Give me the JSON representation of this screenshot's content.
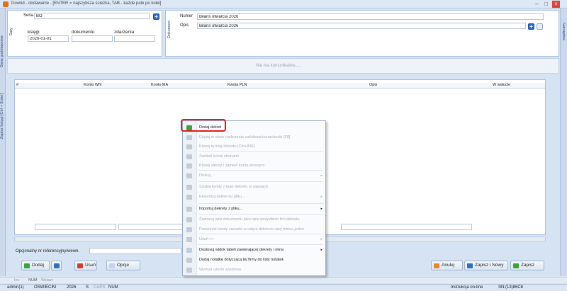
{
  "window": {
    "title": "Dowód - dodawanie - [ENTER = najszybsza ścieżka, TAB - każde pole po kolei]",
    "min": "–",
    "max": "□",
    "close": "×"
  },
  "left_tabs": [
    "Dane podstawowe",
    "Daty",
    "Zapisz księgi [Ctrl + Enter]"
  ],
  "right_tab": "Narzędzia",
  "header": {
    "seria_label": "Seria",
    "seria_value": "BO",
    "daty_label": "Daty",
    "ksiegi_label": "księgi",
    "dokumentu_label": "dokumentu",
    "zdarzenia_label": "zdarzenia",
    "ksiegi_value": "2026-01-01",
    "dokumentu_value": "",
    "zdarzenia_value": "",
    "dokument_tab": "Dokument",
    "numer_label": "Numer",
    "numer_value": "Bilans otwarcia 2026",
    "opis_label": "Opis",
    "opis_value": "Bilans otwarcia 2026"
  },
  "messages": "Nie ma komunikatów.....",
  "grid": {
    "columns": [
      "#",
      "Konto WN",
      "Konto MA",
      "Kwota PLN",
      "Opis",
      "W walucie"
    ]
  },
  "referencyjny_label": "Opcjonalny nr referencyjny/wewn.",
  "buttons": {
    "dodaj": "Dodaj",
    "usun": "Usuń",
    "opcje": "Opcje",
    "anuluj": "Anuluj",
    "zapisz_nowy": "Zapisz i Nowy",
    "zapisz": "Zapisz"
  },
  "context_menu": [
    {
      "label": "Dodaj dekret",
      "disabled": false,
      "icon": "plus-icon",
      "color": "#3aa33a"
    },
    {
      "label": "Edytuj w oknie rozliczenia walutowe/rozrachunki [F8]",
      "disabled": true,
      "icon": "edit-icon"
    },
    {
      "label": "Klonuj tę linię dekretu [Ctrl+INS]",
      "disabled": true,
      "icon": "clone-icon"
    },
    {
      "label": "Zamień konta stronami",
      "disabled": true,
      "icon": "swap-icon"
    },
    {
      "label": "Klonuj wiersz i zamień konta stronami",
      "disabled": true,
      "icon": "clone-swap-icon"
    },
    {
      "label": "Drukuj...",
      "disabled": true,
      "icon": "print-icon",
      "submenu": true
    },
    {
      "label": "Szukaj kwoty z tego dekretu w zapisach",
      "disabled": true,
      "icon": "search-icon"
    },
    {
      "label": "Eksportuj dekret do pliku...",
      "disabled": true,
      "icon": "export-icon",
      "submenu": true
    },
    {
      "label": "Importuj dekrety z pliku...",
      "disabled": false,
      "icon": "import-icon",
      "submenu": true
    },
    {
      "label": "Zastosuj opis dokumentu jako opis wszystkich linii dekretu",
      "disabled": true,
      "icon": "apply-icon"
    },
    {
      "label": "Przemnóż kwoty zawarte w całym dekrecie razy minus jeden",
      "disabled": true,
      "icon": "multiply-icon"
    },
    {
      "label": "Usuń >>",
      "disabled": true,
      "icon": "delete-icon",
      "submenu": true
    },
    {
      "label": "Dostosuj widok tabeli zawierającej dekrety i okna",
      "disabled": false,
      "icon": "table-icon",
      "submenu": true
    },
    {
      "label": "Dodaj notatkę dotyczącą tej firmy do listy notatek",
      "disabled": false,
      "icon": "note-icon"
    },
    {
      "label": "Wymuś użycie szablonu",
      "disabled": true,
      "icon": "template-icon"
    }
  ],
  "keyboard": {
    "ins": "Ins",
    "num": "NUM",
    "wstaw": "Wstaw"
  },
  "status": {
    "user": "admin(1)",
    "company": "OSWIECIM",
    "year": "2026",
    "mode": "S",
    "caps": "CAPS",
    "num": "NUM",
    "instrukcja": "Instrukcja on-line",
    "sn": "SN:(13)86C8"
  }
}
